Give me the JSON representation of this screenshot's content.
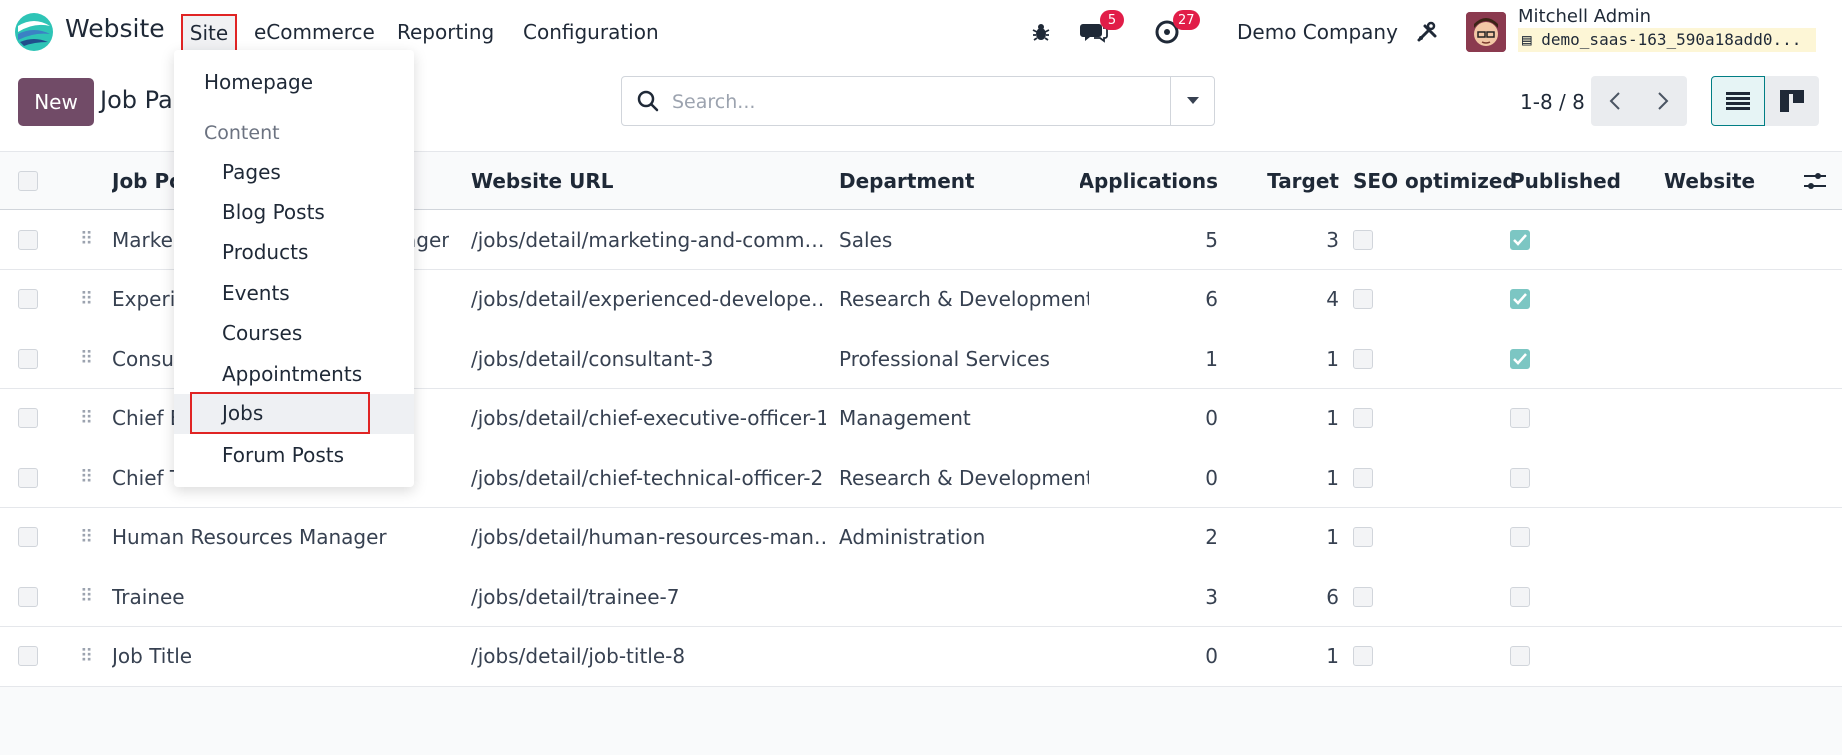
{
  "navbar": {
    "app_name": "Website",
    "menus": [
      "Site",
      "eCommerce",
      "Reporting",
      "Configuration"
    ],
    "messages_count": "5",
    "activities_count": "27",
    "company": "Demo Company",
    "user_name": "Mitchell Admin",
    "db_name": "demo_saas-163_590a18add0..."
  },
  "control": {
    "new_label": "New",
    "breadcrumb": "Job Pa",
    "search_placeholder": "Search...",
    "pager": "1-8 / 8"
  },
  "site_dropdown": {
    "homepage": "Homepage",
    "content_header": "Content",
    "items": [
      "Pages",
      "Blog Posts",
      "Products",
      "Events",
      "Courses",
      "Appointments",
      "Jobs",
      "Forum Posts"
    ]
  },
  "table": {
    "columns": [
      "Job Po",
      "Website URL",
      "Department",
      "Applications",
      "Target",
      "SEO optimized",
      "Published",
      "Website"
    ],
    "rows": [
      {
        "name": "Marke",
        "name_tail": "ager",
        "url": "/jobs/detail/marketing-and-comm…",
        "department": "Sales",
        "applications": "5",
        "target": "3",
        "published": true
      },
      {
        "name": "Experi",
        "name_tail": "",
        "url": "/jobs/detail/experienced-develope…",
        "department": "Research & Development",
        "applications": "6",
        "target": "4",
        "published": true
      },
      {
        "name": "Consul",
        "name_tail": "",
        "url": "/jobs/detail/consultant-3",
        "department": "Professional Services",
        "applications": "1",
        "target": "1",
        "published": true
      },
      {
        "name": "Chief E",
        "name_tail": "",
        "url": "/jobs/detail/chief-executive-officer-1",
        "department": "Management",
        "applications": "0",
        "target": "1",
        "published": false
      },
      {
        "name": "Chief T",
        "name_tail": "",
        "url": "/jobs/detail/chief-technical-officer-2",
        "department": "Research & Development",
        "applications": "0",
        "target": "1",
        "published": false
      },
      {
        "name": "Human Resources Manager",
        "name_tail": "",
        "url": "/jobs/detail/human-resources-man…",
        "department": "Administration",
        "applications": "2",
        "target": "1",
        "published": false
      },
      {
        "name": "Trainee",
        "name_tail": "",
        "url": "/jobs/detail/trainee-7",
        "department": "",
        "applications": "3",
        "target": "6",
        "published": false
      },
      {
        "name": "Job Title",
        "name_tail": "",
        "url": "/jobs/detail/job-title-8",
        "department": "",
        "applications": "0",
        "target": "1",
        "published": false
      }
    ]
  },
  "colors": {
    "brand": "#714b67",
    "accent": "#017e84",
    "highlight_border": "#e02424",
    "badge": "#e11d48"
  }
}
